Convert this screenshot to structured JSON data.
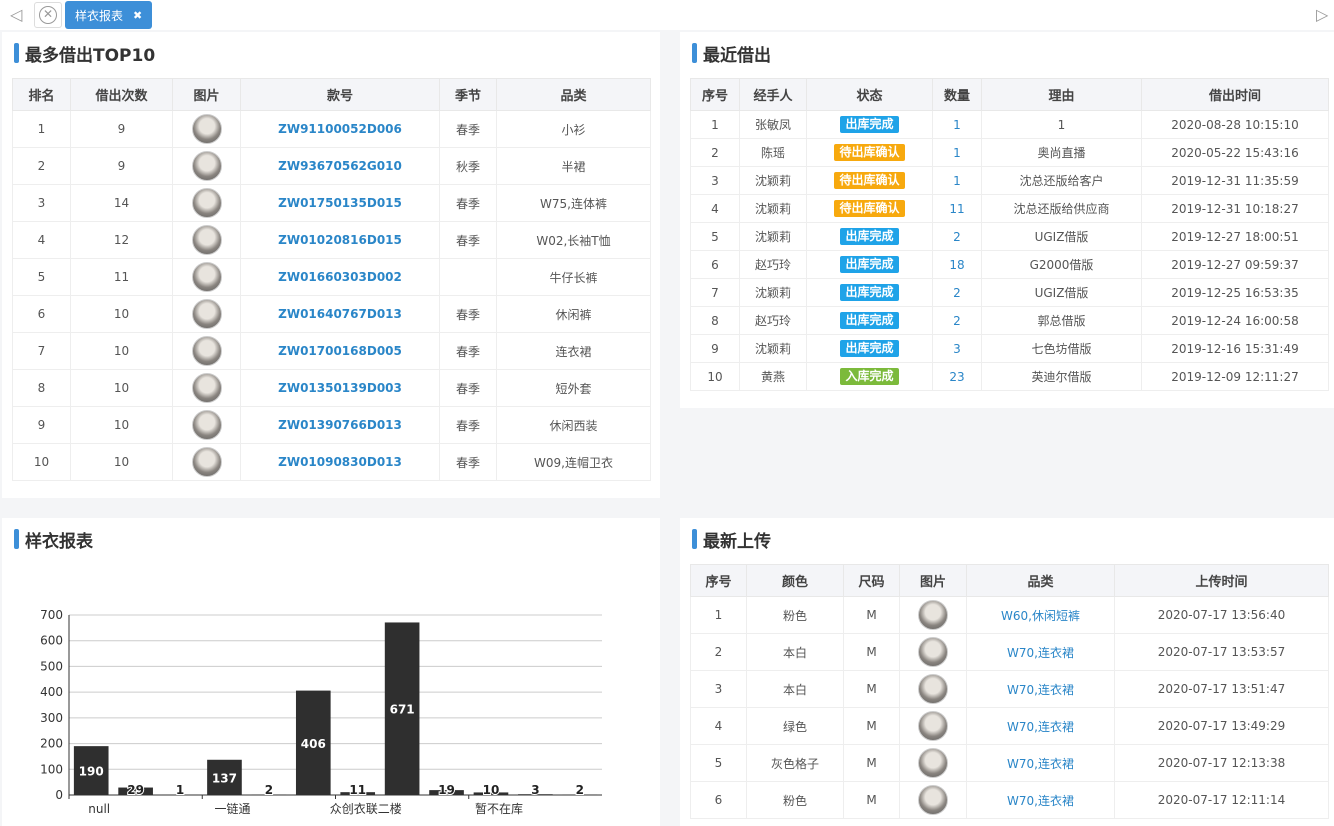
{
  "tabbar": {
    "active_tab": "样衣报表",
    "close_glyph": "✖"
  },
  "top10": {
    "title": "最多借出TOP10",
    "headers": [
      "排名",
      "借出次数",
      "图片",
      "款号",
      "季节",
      "品类"
    ],
    "rows": [
      [
        "1",
        "9",
        "",
        "ZW91100052D006",
        "春季",
        "小衫"
      ],
      [
        "2",
        "9",
        "",
        "ZW93670562G010",
        "秋季",
        "半裙"
      ],
      [
        "3",
        "14",
        "",
        "ZW01750135D015",
        "春季",
        "W75,连体裤"
      ],
      [
        "4",
        "12",
        "",
        "ZW01020816D015",
        "春季",
        "W02,长袖T恤"
      ],
      [
        "5",
        "11",
        "",
        "ZW01660303D002",
        "",
        "牛仔长裤"
      ],
      [
        "6",
        "10",
        "",
        "ZW01640767D013",
        "春季",
        "休闲裤"
      ],
      [
        "7",
        "10",
        "",
        "ZW01700168D005",
        "春季",
        "连衣裙"
      ],
      [
        "8",
        "10",
        "",
        "ZW01350139D003",
        "春季",
        "短外套"
      ],
      [
        "9",
        "10",
        "",
        "ZW01390766D013",
        "春季",
        "休闲西装"
      ],
      [
        "10",
        "10",
        "",
        "ZW01090830D013",
        "春季",
        "W09,连帽卫衣"
      ]
    ]
  },
  "recent": {
    "title": "最近借出",
    "headers": [
      "序号",
      "经手人",
      "状态",
      "数量",
      "理由",
      "借出时间"
    ],
    "rows": [
      [
        "1",
        "张敏凤",
        "出库完成",
        "1",
        "1",
        "2020-08-28 10:15:10"
      ],
      [
        "2",
        "陈瑶",
        "待出库确认",
        "1",
        "奥尚直播",
        "2020-05-22 15:43:16"
      ],
      [
        "3",
        "沈颖莉",
        "待出库确认",
        "1",
        "沈总还版给客户",
        "2019-12-31 11:35:59"
      ],
      [
        "4",
        "沈颖莉",
        "待出库确认",
        "11",
        "沈总还版给供应商",
        "2019-12-31 10:18:27"
      ],
      [
        "5",
        "沈颖莉",
        "出库完成",
        "2",
        "UGIZ借版",
        "2019-12-27 18:00:51"
      ],
      [
        "6",
        "赵巧玲",
        "出库完成",
        "18",
        "G2000借版",
        "2019-12-27 09:59:37"
      ],
      [
        "7",
        "沈颖莉",
        "出库完成",
        "2",
        "UGIZ借版",
        "2019-12-25 16:53:35"
      ],
      [
        "8",
        "赵巧玲",
        "出库完成",
        "2",
        "郭总借版",
        "2019-12-24 16:00:58"
      ],
      [
        "9",
        "沈颖莉",
        "出库完成",
        "3",
        "七色坊借版",
        "2019-12-16 15:31:49"
      ],
      [
        "10",
        "黄燕",
        "入库完成",
        "23",
        "英迪尔借版",
        "2019-12-09 12:11:27"
      ]
    ],
    "status_colors": {
      "出库完成": "#1fa3e8",
      "待出库确认": "#f7a90e",
      "入库完成": "#7cba3b"
    }
  },
  "report": {
    "title": "样衣报表"
  },
  "chart_data": {
    "type": "bar",
    "values": [
      190,
      29,
      1,
      137,
      2,
      406,
      11,
      671,
      19,
      10,
      3,
      2
    ],
    "tick_labels": [
      "null",
      "一链通",
      "众创衣联二楼",
      "暂不在库"
    ],
    "tick_label_bars": [
      0,
      3,
      6,
      9
    ],
    "ylim": [
      0,
      700
    ],
    "yticks": [
      0,
      100,
      200,
      300,
      400,
      500,
      600,
      700
    ],
    "bar_color": "#2f2f2f",
    "grid": true,
    "title": "",
    "xlabel": "",
    "ylabel": ""
  },
  "uploads": {
    "title": "最新上传",
    "headers": [
      "序号",
      "颜色",
      "尺码",
      "图片",
      "品类",
      "上传时间"
    ],
    "rows": [
      [
        "1",
        "粉色",
        "M",
        "",
        "W60,休闲短裤",
        "2020-07-17 13:56:40"
      ],
      [
        "2",
        "本白",
        "M",
        "",
        "W70,连衣裙",
        "2020-07-17 13:53:57"
      ],
      [
        "3",
        "本白",
        "M",
        "",
        "W70,连衣裙",
        "2020-07-17 13:51:47"
      ],
      [
        "4",
        "绿色",
        "M",
        "",
        "W70,连衣裙",
        "2020-07-17 13:49:29"
      ],
      [
        "5",
        "灰色格子",
        "M",
        "",
        "W70,连衣裙",
        "2020-07-17 12:13:38"
      ],
      [
        "6",
        "粉色",
        "M",
        "",
        "W70,连衣裙",
        "2020-07-17 12:11:14"
      ]
    ]
  }
}
